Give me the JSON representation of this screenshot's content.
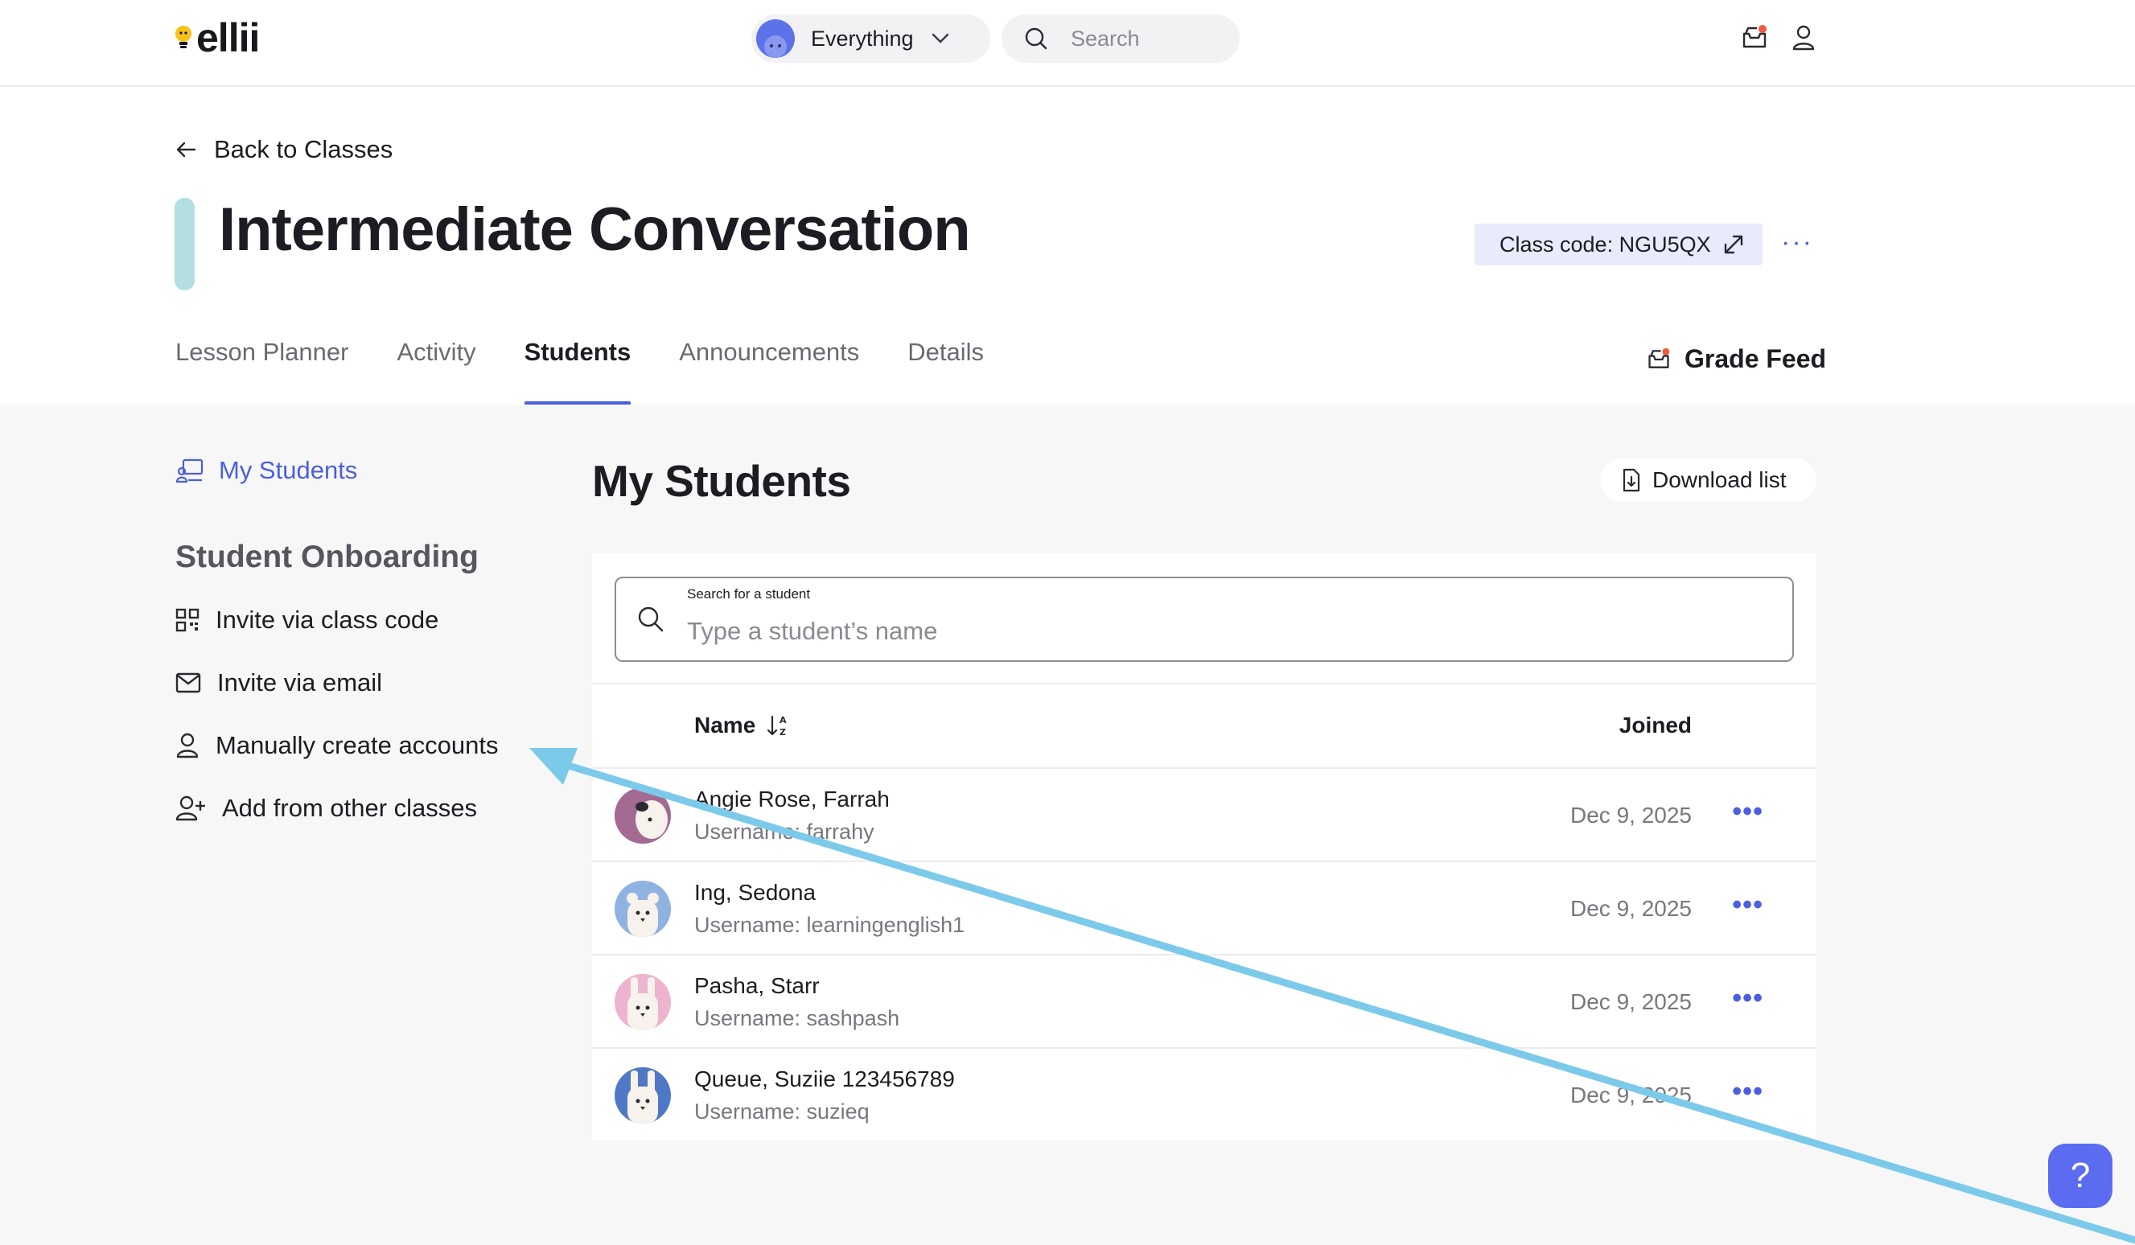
{
  "app": {
    "logo_text": "ellii"
  },
  "topbar": {
    "scope_label": "Everything",
    "search_placeholder": "Search"
  },
  "header": {
    "back_label": "Back to Classes",
    "class_title": "Intermediate Conversation",
    "class_code_label": "Class code: NGU5QX",
    "more_label": "···"
  },
  "tabs": [
    {
      "label": "Lesson Planner",
      "active": false
    },
    {
      "label": "Activity",
      "active": false
    },
    {
      "label": "Students",
      "active": true
    },
    {
      "label": "Announcements",
      "active": false
    },
    {
      "label": "Details",
      "active": false
    }
  ],
  "grade_feed_label": "Grade Feed",
  "sidebar": {
    "my_students_label": "My Students",
    "onboarding_heading": "Student Onboarding",
    "items": [
      {
        "label": "Invite via class code",
        "icon": "qr-code-icon"
      },
      {
        "label": "Invite via email",
        "icon": "envelope-icon"
      },
      {
        "label": "Manually create accounts",
        "icon": "person-icon"
      },
      {
        "label": "Add from other classes",
        "icon": "person-add-icon"
      }
    ]
  },
  "main": {
    "title": "My Students",
    "download_label": "Download list",
    "search_label": "Search for a student",
    "search_placeholder": "Type a student’s name",
    "columns": {
      "name": "Name",
      "joined": "Joined"
    },
    "students": [
      {
        "name": "Angie Rose, Farrah",
        "username": "Username: farrahy",
        "joined": "Dec 9, 2025",
        "avatar_color": "#a36a92"
      },
      {
        "name": "Ing, Sedona",
        "username": "Username: learningenglish1",
        "joined": "Dec 9, 2025",
        "avatar_color": "#8fb3e0"
      },
      {
        "name": "Pasha, Starr",
        "username": "Username: sashpash",
        "joined": "Dec 9, 2025",
        "avatar_color": "#eeb4cf"
      },
      {
        "name": "Queue, Suziie 123456789",
        "username": "Username: suzieq",
        "joined": "Dec 9, 2025",
        "avatar_color": "#4f79c6"
      }
    ],
    "row_more_label": "•••"
  },
  "help_label": "?",
  "colors": {
    "accent": "#4b5fe0",
    "annotation_arrow": "#7ccaea",
    "class_color": "#b3dfe2"
  }
}
